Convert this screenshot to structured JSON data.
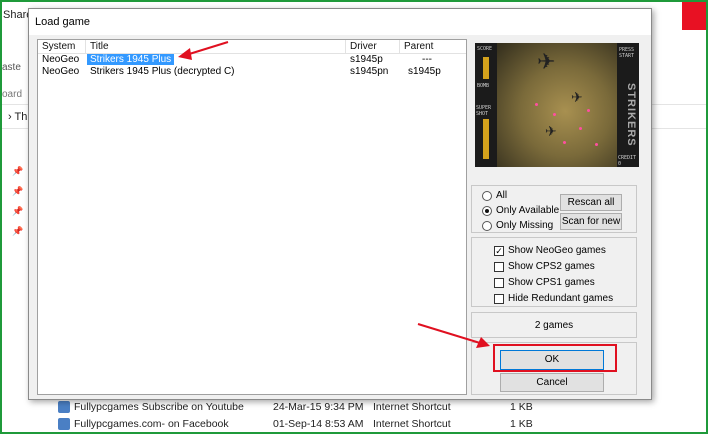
{
  "background": {
    "ribbon_share": "Share",
    "ribbon_paste": "aste",
    "ribbon_clipboard": "oard",
    "address_prefix": "Th",
    "rows": [
      {
        "name": "Fullypcgames Subscribe on Youtube",
        "date": "24-Mar-15 9:34 PM",
        "type": "Internet Shortcut",
        "size": "1 KB"
      },
      {
        "name": "Fullypcgames.com- on Facebook",
        "date": "01-Sep-14 8:53 AM",
        "type": "Internet Shortcut",
        "size": "1 KB"
      }
    ]
  },
  "dialog": {
    "title": "Load game",
    "columns": [
      "System",
      "Title",
      "Driver",
      "Parent"
    ],
    "games": [
      {
        "system": "NeoGeo",
        "title": "Strikers 1945 Plus",
        "driver": "s1945p",
        "parent": "---",
        "selected": true
      },
      {
        "system": "NeoGeo",
        "title": "Strikers 1945 Plus (decrypted C)",
        "driver": "s1945pn",
        "parent": "s1945p",
        "selected": false
      }
    ],
    "preview": {
      "logo": "STRIKERS",
      "hud_score": "SCORE",
      "hud_bomb": "BOMB",
      "hud_press": "PRESS",
      "hud_start": "START",
      "hud_credit": "CREDIT 0",
      "hud_super_shot": "SUPER SHOT"
    },
    "filter_options": {
      "all": "All",
      "only_available": "Only Available",
      "only_missing": "Only Missing",
      "selected": "only_available"
    },
    "buttons": {
      "rescan_all": "Rescan all",
      "scan_for_new": "Scan for new",
      "ok": "OK",
      "cancel": "Cancel"
    },
    "show_options": [
      {
        "label": "Show NeoGeo games",
        "checked": true
      },
      {
        "label": "Show CPS2 games",
        "checked": false
      },
      {
        "label": "Show CPS1 games",
        "checked": false
      },
      {
        "label": "Hide Redundant games",
        "checked": false
      }
    ],
    "games_count": "2 games"
  },
  "colors": {
    "frame": "#1f9a3a",
    "annotation": "#e01020",
    "selection": "#3399ff"
  }
}
